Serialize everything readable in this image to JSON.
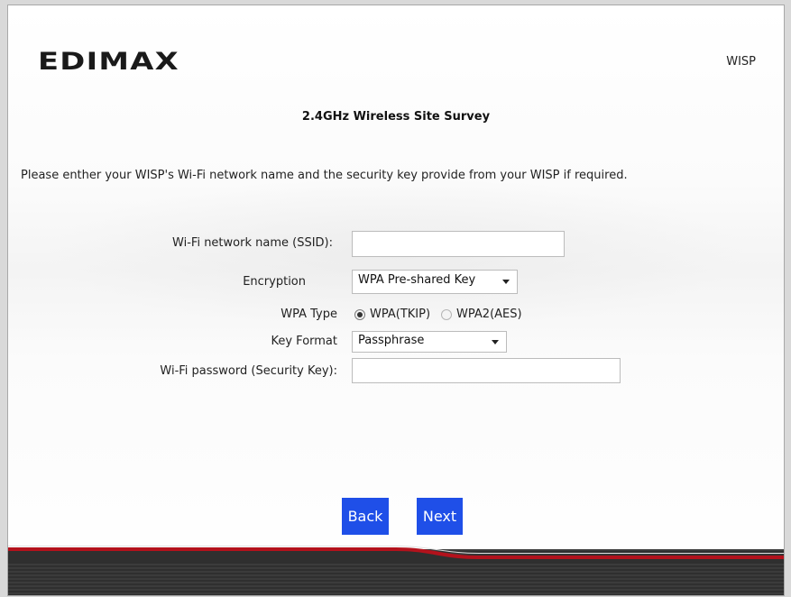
{
  "header": {
    "logo_text": "EDIMAX",
    "mode": "WISP"
  },
  "page": {
    "title": "2.4GHz  Wireless Site Survey",
    "instruction": "Please enther your WISP's Wi-Fi network name and the security key provide from your WISP if required."
  },
  "form": {
    "ssid_label": "Wi-Fi network name (SSID):",
    "ssid_value": "",
    "encryption_label": "Encryption",
    "encryption_value": "WPA Pre-shared Key",
    "wpa_type_label": "WPA Type",
    "wpa_options": [
      {
        "label": "WPA(TKIP)",
        "checked": true
      },
      {
        "label": "WPA2(AES)",
        "checked": false
      }
    ],
    "key_format_label": "Key Format",
    "key_format_value": "Passphrase",
    "password_label": "Wi-Fi password (Security Key):",
    "password_value": ""
  },
  "buttons": {
    "back": "Back",
    "next": "Next"
  },
  "colors": {
    "button": "#1f4fe8",
    "footer_band": "#3b3b3b",
    "accent_red": "#b3121c"
  }
}
